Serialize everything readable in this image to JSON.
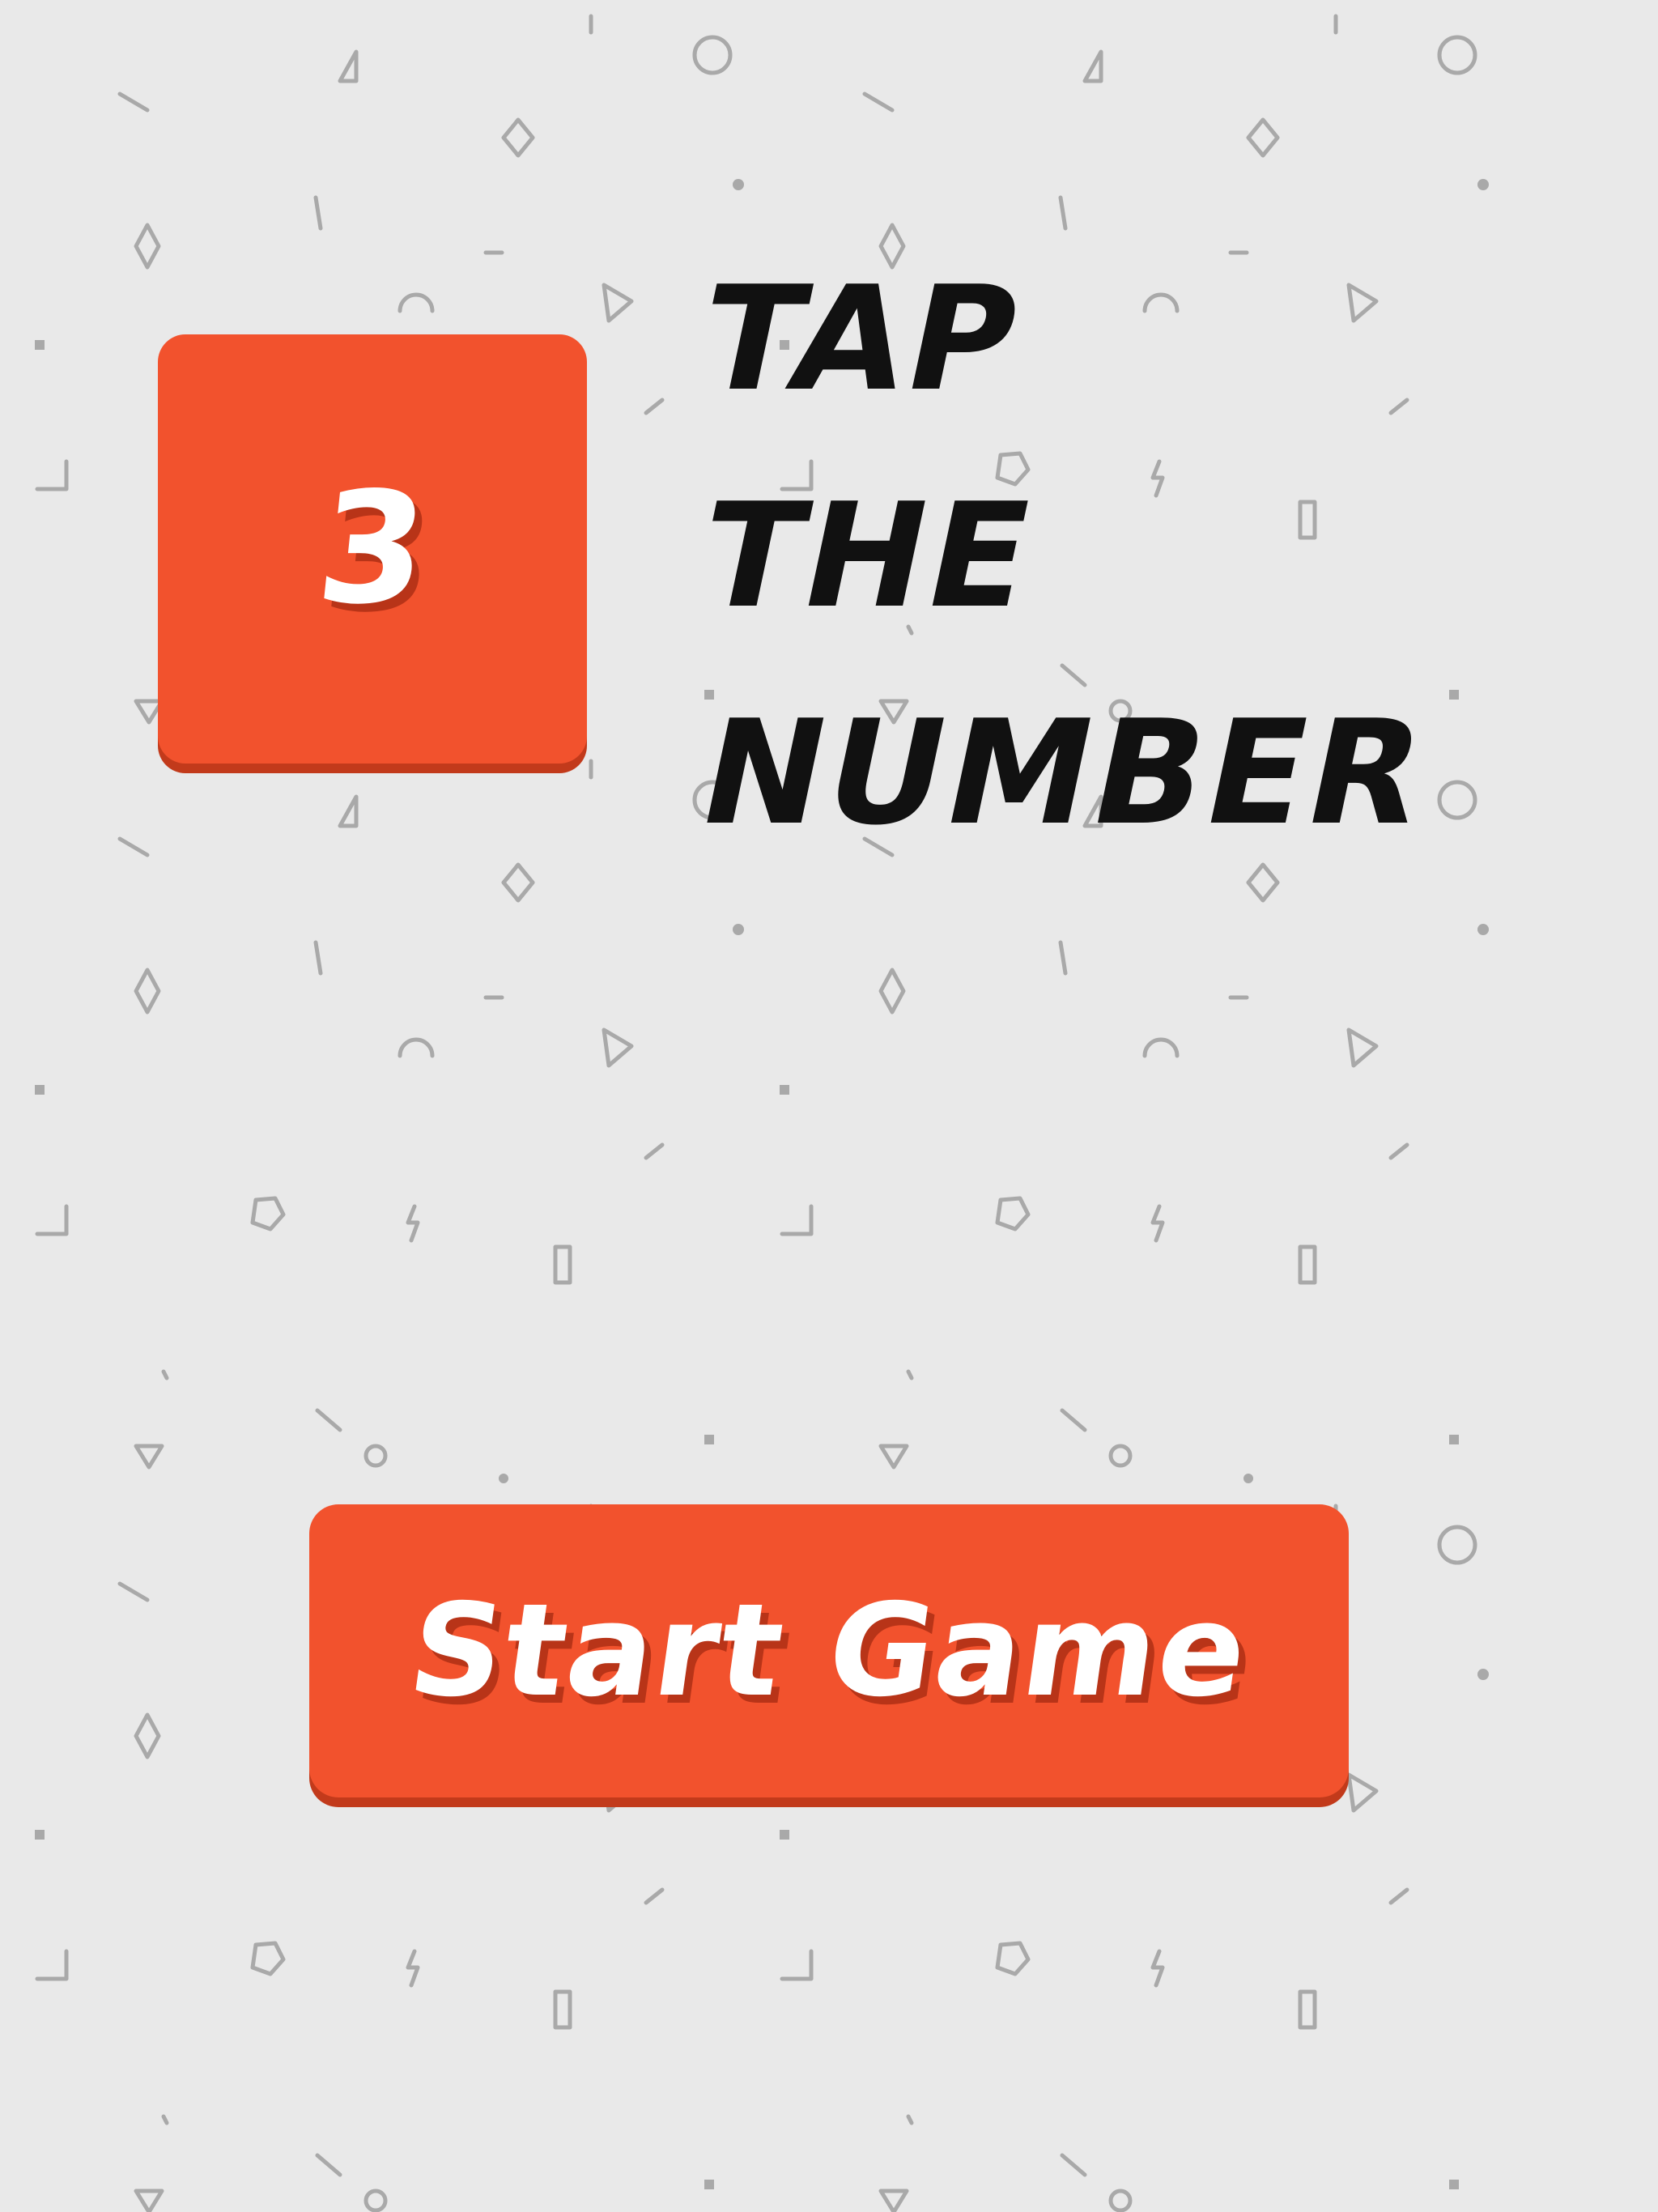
{
  "game": {
    "tile_number": "3",
    "title_lines": [
      "TAP",
      "THE",
      "NUMBER"
    ],
    "start_button_label": "Start Game"
  },
  "colors": {
    "background": "#e9e9e9",
    "accent": "#f2522d",
    "accent_shadow": "#c23a1b",
    "title_text": "#111111",
    "button_text": "#ffffff",
    "pattern": "#a8a8a8"
  }
}
